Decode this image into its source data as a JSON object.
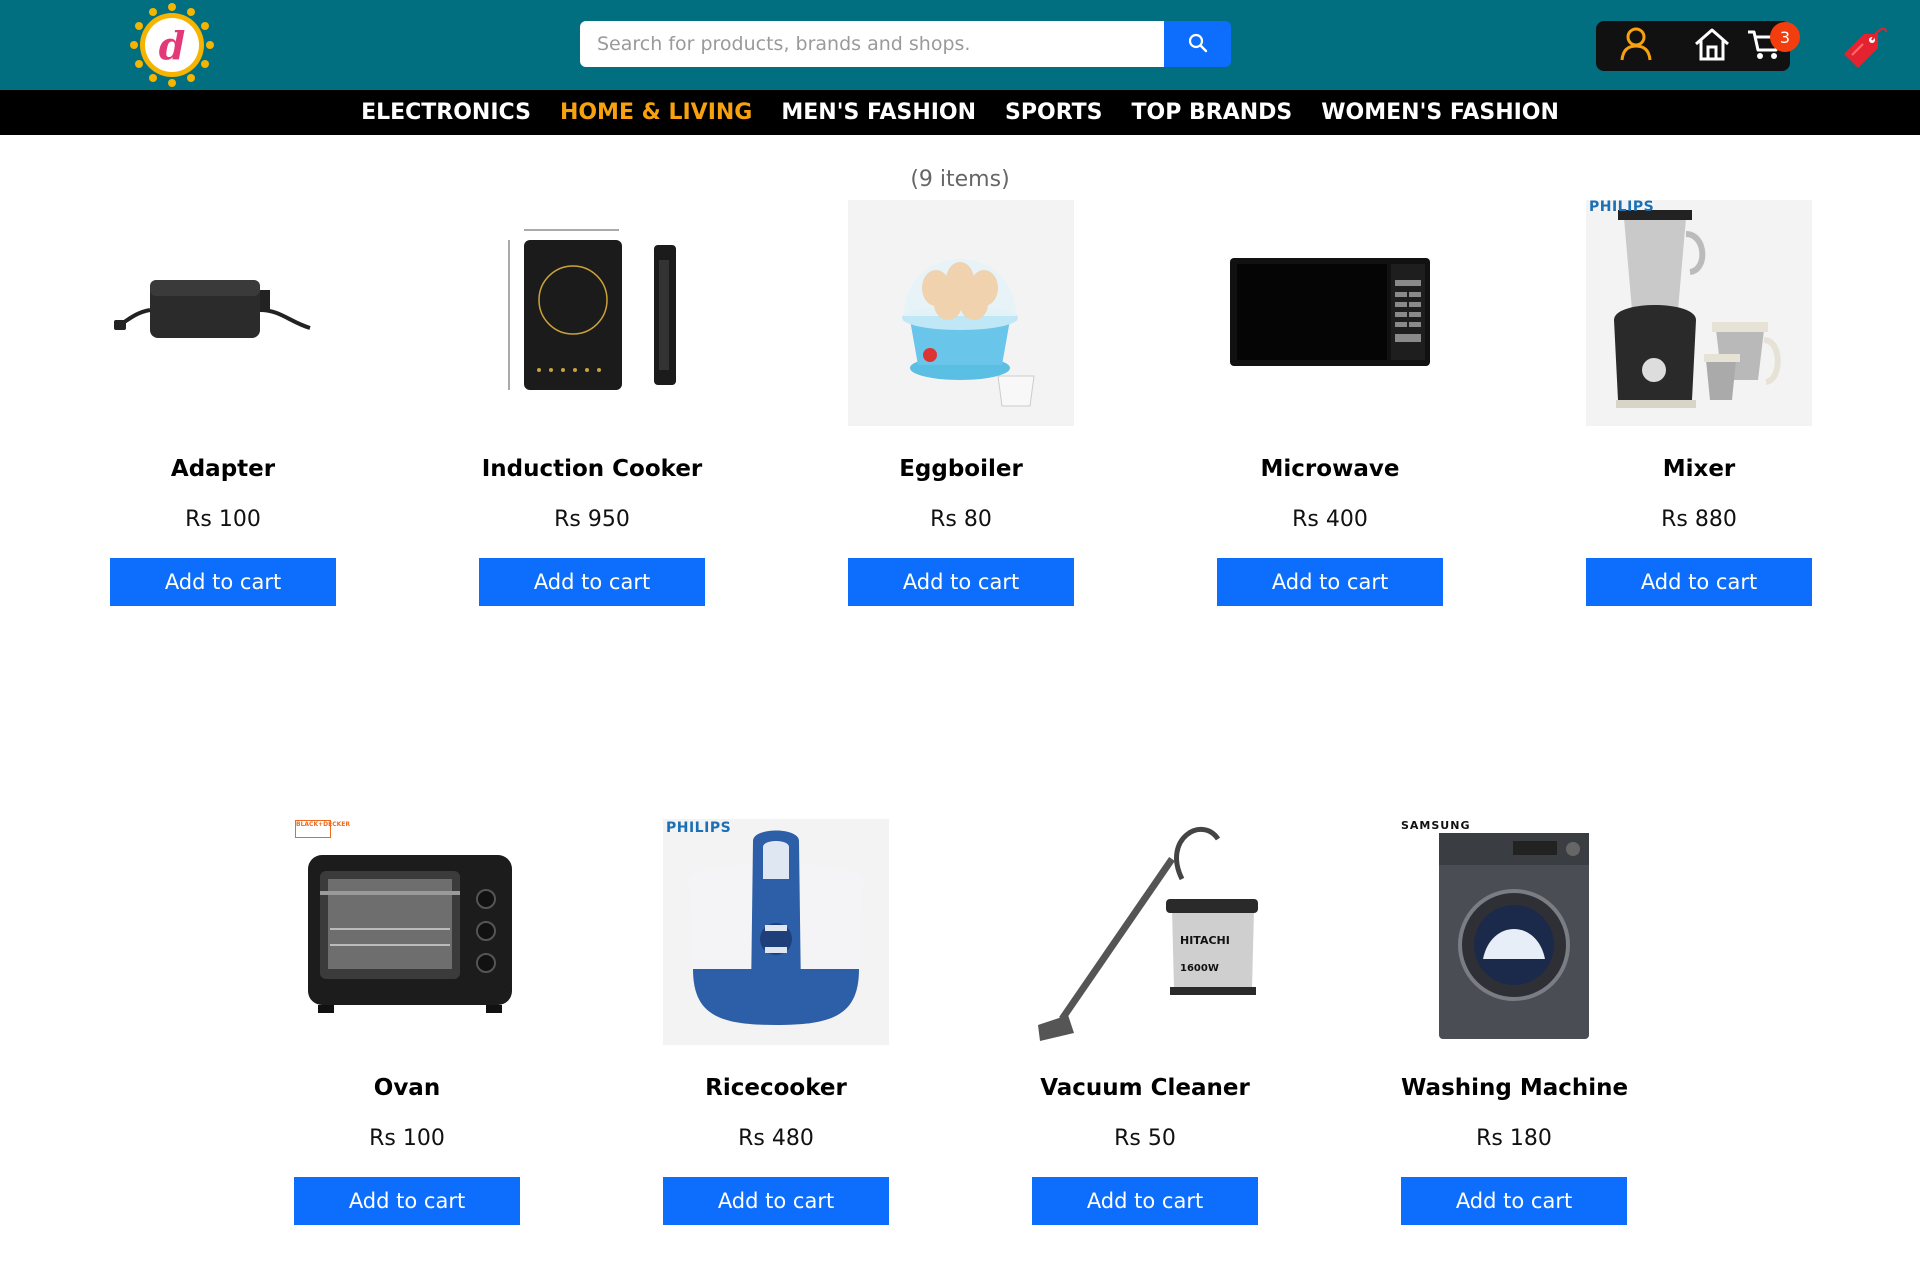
{
  "header": {
    "logo_letter": "d",
    "search": {
      "placeholder": "Search for products, brands and shops.",
      "value": ""
    },
    "cart_count": "3"
  },
  "nav": {
    "categories": [
      {
        "label": "ELECTRONICS",
        "active": false
      },
      {
        "label": "HOME & LIVING",
        "active": true
      },
      {
        "label": "MEN'S FASHION",
        "active": false
      },
      {
        "label": "SPORTS",
        "active": false
      },
      {
        "label": "TOP BRANDS",
        "active": false
      },
      {
        "label": "WOMEN'S FASHION",
        "active": false
      }
    ]
  },
  "content": {
    "items_count": "(9 items)",
    "products": [
      {
        "name": "Adapter",
        "price": "Rs 100",
        "button": "Add to cart",
        "image": "adapter-image"
      },
      {
        "name": "Induction Cooker",
        "price": "Rs 950",
        "button": "Add to cart",
        "image": "induction-cooker-image"
      },
      {
        "name": "Eggboiler",
        "price": "Rs 80",
        "button": "Add to cart",
        "image": "eggboiler-image"
      },
      {
        "name": "Microwave",
        "price": "Rs 400",
        "button": "Add to cart",
        "image": "microwave-image"
      },
      {
        "name": "Mixer",
        "price": "Rs 880",
        "button": "Add to cart",
        "image": "mixer-image",
        "brand": "PHILIPS"
      },
      {
        "name": "Ovan",
        "price": "Rs 100",
        "button": "Add to cart",
        "image": "oven-image",
        "brand": "BLACK+DECKER"
      },
      {
        "name": "Ricecooker",
        "price": "Rs 480",
        "button": "Add to cart",
        "image": "ricecooker-image",
        "brand": "PHILIPS"
      },
      {
        "name": "Vacuum Cleaner",
        "price": "Rs 50",
        "button": "Add to cart",
        "image": "vacuum-cleaner-image",
        "brand": "HITACHI",
        "wattage": "1600W"
      },
      {
        "name": "Washing Machine",
        "price": "Rs 180",
        "button": "Add to cart",
        "image": "washing-machine-image",
        "brand": "SAMSUNG"
      }
    ]
  },
  "colors": {
    "header_bg": "#026f80",
    "nav_bg": "#000000",
    "nav_active": "#f7a10f",
    "button_blue": "#0d6efd",
    "badge_red": "#f23d0e",
    "icon_orange": "#f7a10f"
  }
}
